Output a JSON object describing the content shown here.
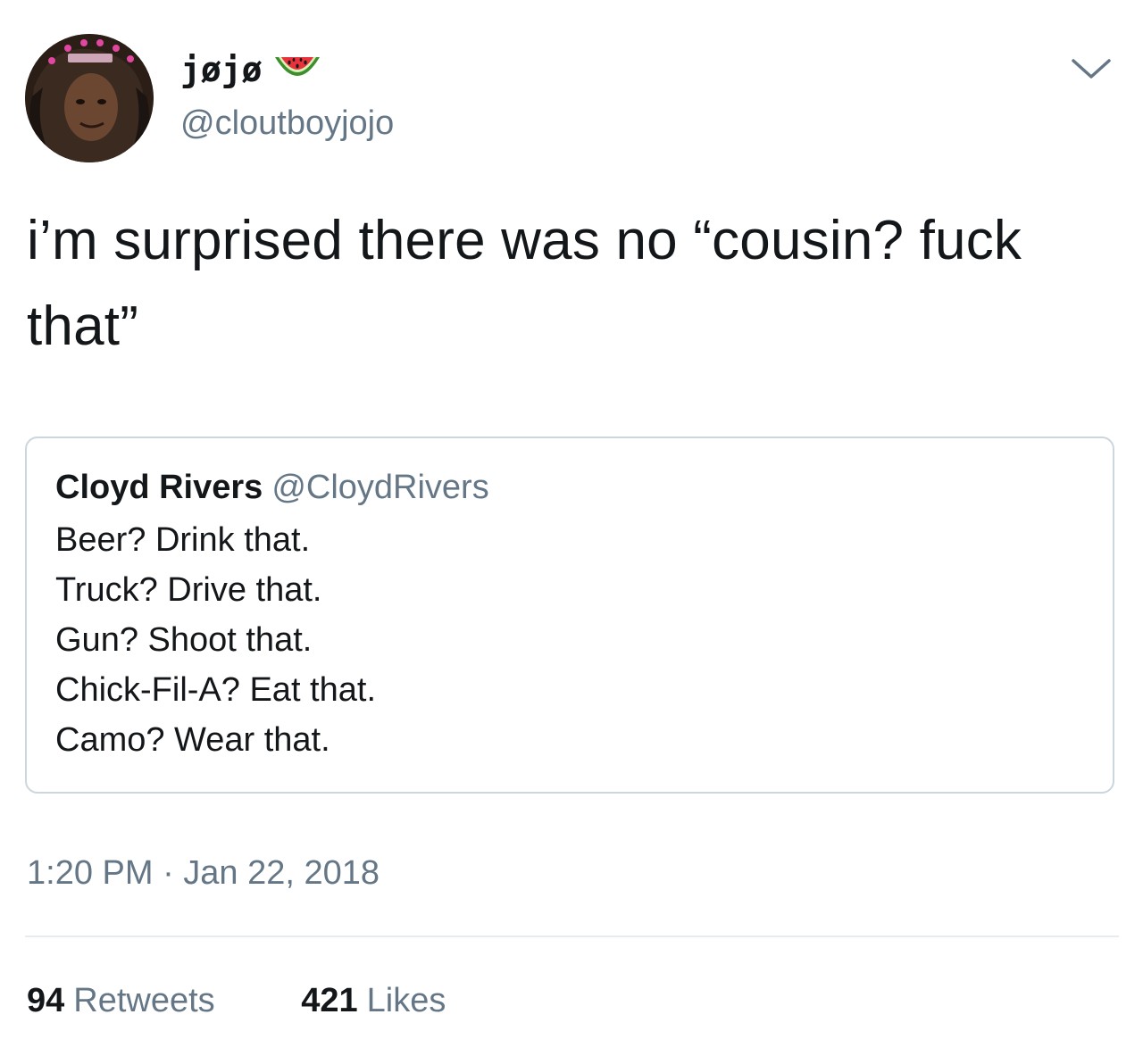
{
  "author": {
    "display_name": "jøjø",
    "name_emoji": "watermelon-icon",
    "handle": "@cloutboyjojo",
    "avatar_icon": "avatar"
  },
  "menu_icon": "chevron-down-icon",
  "tweet": {
    "text": "i’m surprised there was no “cousin? fuck that”"
  },
  "quoted_tweet": {
    "name": "Cloyd Rivers",
    "handle": "@CloydRivers",
    "lines": [
      "Beer? Drink that.",
      "Truck? Drive that.",
      "Gun? Shoot that.",
      "Chick-Fil-A? Eat that.",
      "Camo? Wear that."
    ]
  },
  "timestamp": "1:20 PM · Jan 22, 2018",
  "stats": {
    "retweets_count": "94",
    "retweets_label": "Retweets",
    "likes_count": "421",
    "likes_label": "Likes"
  },
  "colors": {
    "text_primary": "#14171a",
    "text_secondary": "#657786",
    "border": "#ccd6dd",
    "divider": "#e6ecf0"
  }
}
